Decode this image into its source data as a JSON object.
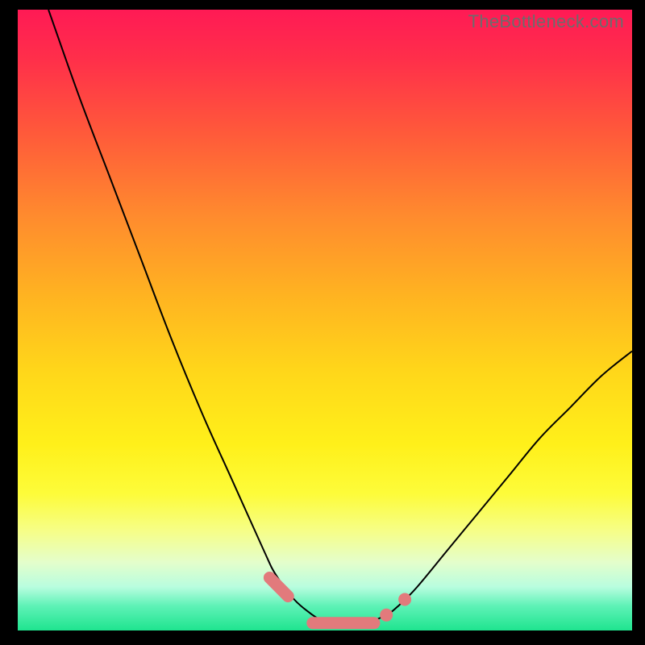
{
  "watermark": "TheBottleneck.com",
  "colors": {
    "background": "#000000",
    "curve": "#000000",
    "marker": "#e27a7c",
    "gradient_top": "#ff1a55",
    "gradient_bottom": "#1fe48f"
  },
  "chart_data": {
    "type": "line",
    "title": "",
    "xlabel": "",
    "ylabel": "",
    "xlim": [
      0,
      100
    ],
    "ylim": [
      0,
      100
    ],
    "annotations": [
      "TheBottleneck.com"
    ],
    "series": [
      {
        "name": "bottleneck-curve",
        "x": [
          5,
          10,
          15,
          20,
          25,
          30,
          35,
          40,
          42,
          45,
          48,
          50,
          52,
          55,
          57,
          60,
          62,
          65,
          70,
          75,
          80,
          85,
          90,
          95,
          100
        ],
        "y": [
          100,
          86,
          73,
          60,
          47,
          35,
          24,
          13,
          9,
          5,
          2.5,
          1.4,
          1,
          1,
          1.3,
          2.5,
          4,
          7,
          13,
          19,
          25,
          31,
          36,
          41,
          45
        ]
      }
    ],
    "markers": [
      {
        "name": "left-marker",
        "x_range": [
          41,
          44
        ],
        "y": 6.5
      },
      {
        "name": "floor-marker",
        "x_range": [
          48,
          58
        ],
        "y": 1.2
      },
      {
        "name": "right-dot-1",
        "x": 60,
        "y": 2.5
      },
      {
        "name": "right-dot-2",
        "x": 63,
        "y": 5
      }
    ]
  }
}
